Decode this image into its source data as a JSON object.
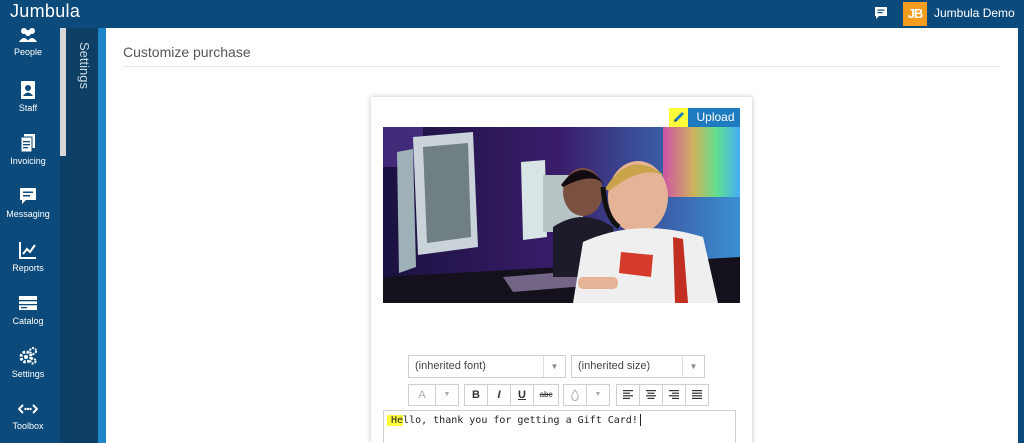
{
  "app": {
    "brand": "Jumbula",
    "user_name": "Jumbula Demo",
    "logo_text": "JB",
    "accent": "#0b4a7a",
    "logo_color": "#f39c1e",
    "highlight": "#ffff3a"
  },
  "nav": {
    "items": [
      {
        "label": "People",
        "icon": "people-icon"
      },
      {
        "label": "Staff",
        "icon": "staff-icon"
      },
      {
        "label": "Invoicing",
        "icon": "invoice-icon"
      },
      {
        "label": "Messaging",
        "icon": "message-icon"
      },
      {
        "label": "Reports",
        "icon": "reports-icon"
      },
      {
        "label": "Catalog",
        "icon": "catalog-icon"
      },
      {
        "label": "Settings",
        "icon": "gears-icon"
      },
      {
        "label": "Toolbox",
        "icon": "toolbox-icon"
      }
    ]
  },
  "settings_strip": {
    "label": "Settings"
  },
  "page": {
    "title": "Customize purchase"
  },
  "card": {
    "upload_label": "Upload",
    "font_select": "(inherited font)",
    "size_select": "(inherited size)",
    "toolbar": {
      "font_color": "A",
      "bold": "B",
      "italic": "I",
      "underline": "U",
      "strike": "abc"
    },
    "message_highlight": "He",
    "message_rest": "llo, thank you for getting a Gift Card!"
  }
}
